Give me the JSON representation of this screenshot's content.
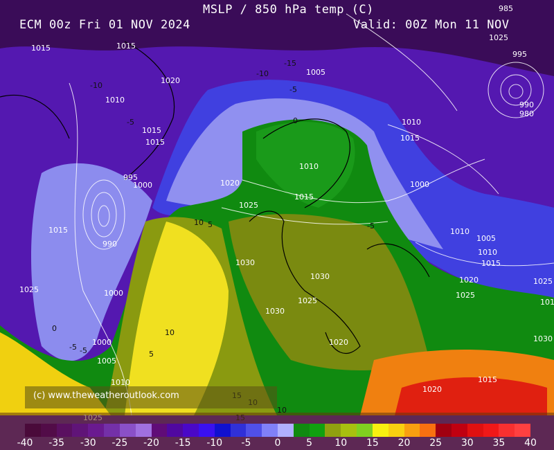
{
  "header": {
    "title": "MSLP / 850 hPa temp (C)",
    "run": "ECM 00z Fri 01 NOV 2024",
    "valid": "Valid: 00Z Mon 11 NOV"
  },
  "credit": "(c) www.theweatheroutlook.com",
  "colorbar": {
    "ticks": [
      "-40",
      "-35",
      "-30",
      "-25",
      "-20",
      "-15",
      "-10",
      "-5",
      "0",
      "5",
      "10",
      "15",
      "20",
      "25",
      "30",
      "35",
      "40"
    ],
    "colors": [
      "#4a0a3a",
      "#520c48",
      "#5a1060",
      "#601478",
      "#6a1a90",
      "#7430a8",
      "#8a50c8",
      "#a070e0",
      "#600c78",
      "#5008a0",
      "#4a08c8",
      "#3a10f0",
      "#1010d0",
      "#3030d8",
      "#5050e8",
      "#8080f8",
      "#b0b0ff",
      "#108a10",
      "#10a010",
      "#90a010",
      "#a8c010",
      "#80d020",
      "#f8f010",
      "#f8d010",
      "#f8a010",
      "#f87010",
      "#a00010",
      "#c00010",
      "#e01010",
      "#f01818",
      "#f83030",
      "#ff4040"
    ]
  },
  "isobar_labels": [
    "1015",
    "1015",
    "1020",
    "1010",
    "1015",
    "1015",
    "995",
    "1000",
    "990",
    "1015",
    "1000",
    "1025",
    "1000",
    "1005",
    "1010",
    "1005",
    "1010",
    "1015",
    "1020",
    "1025",
    "1010",
    "1015",
    "1030",
    "1030",
    "1025",
    "1030",
    "1020",
    "1025",
    "1010",
    "1005",
    "1010",
    "1015",
    "1020",
    "1025",
    "1030",
    "1025",
    "995",
    "990",
    "980",
    "985",
    "1000",
    "1010",
    "1015",
    "1020",
    "1025"
  ],
  "temp_labels": [
    "-15",
    "-10",
    "-5",
    "-10",
    "-5",
    "0",
    "-5",
    "5",
    "10",
    "10",
    "5",
    "0",
    "-5",
    "-5",
    "10",
    "15",
    "10",
    "15"
  ],
  "colors": {
    "polar": "#2a0a40",
    "very_cold": "#5a1ab0",
    "cold": "#4040e0",
    "cool": "#9898f0",
    "mild": "#109010",
    "warm_mild": "#7a8a10",
    "warm": "#f0e020",
    "hot": "#f08010"
  }
}
